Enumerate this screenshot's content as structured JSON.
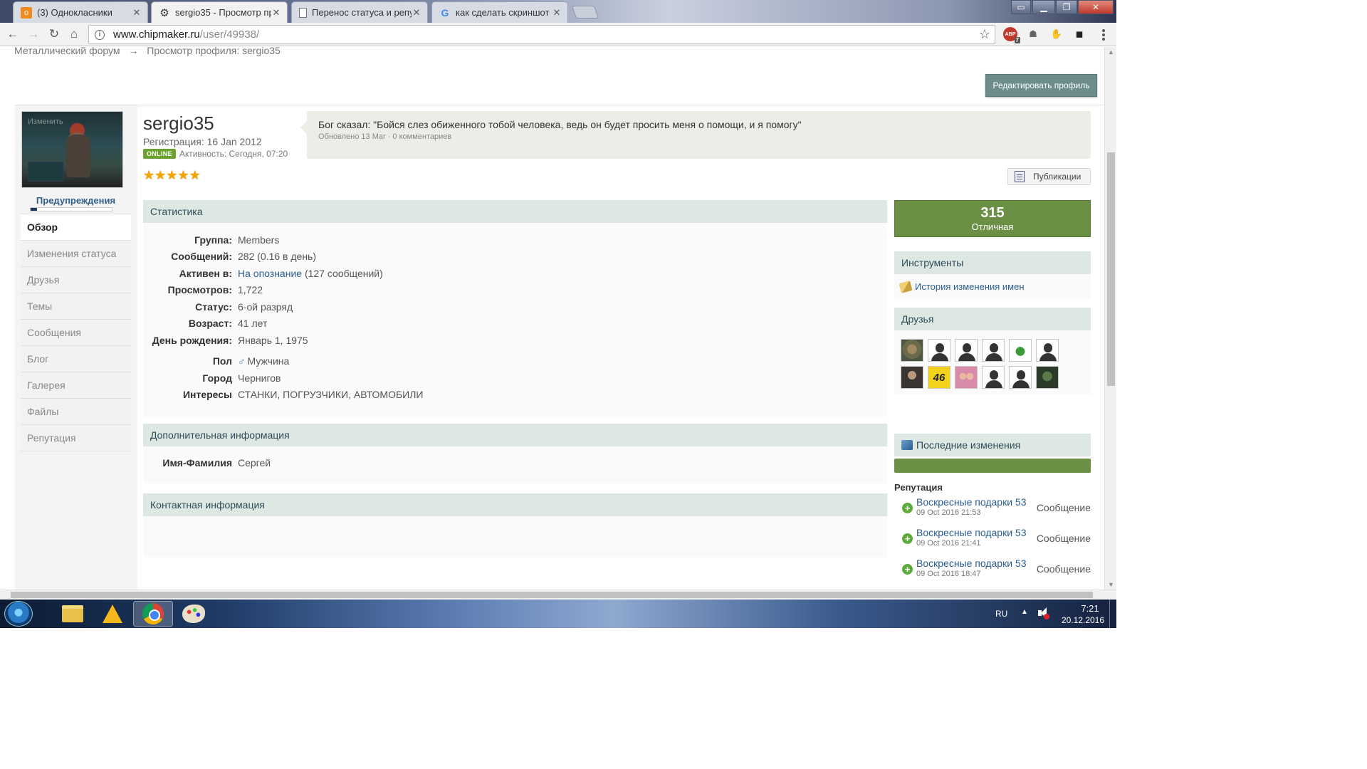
{
  "browser": {
    "tabs": [
      {
        "label": "(3) Однокласники",
        "icon": "ok-icon",
        "active": false
      },
      {
        "label": "sergio35 - Просмотр пр",
        "icon": "gear-icon",
        "active": true
      },
      {
        "label": "Перенос статуса и репу",
        "icon": "document-icon",
        "active": false
      },
      {
        "label": "как сделать скриншот н",
        "icon": "google-icon",
        "active": false
      }
    ],
    "url_host": "www.chipmaker.ru",
    "url_path": "/user/49938/",
    "abp_count": "7",
    "abp_label": "ABP"
  },
  "breadcrumb": {
    "items": [
      "Металлический форум",
      "Просмотр профиля: sergio35"
    ],
    "separator": "→"
  },
  "edit_profile_label": "Редактировать профиль",
  "profile": {
    "avatar_change_label": "Изменить",
    "warnings_label": "Предупреждения",
    "warnings_level": 0.08,
    "username": "sergio35",
    "registration": "Регистрация: 16 Jan 2012",
    "online_badge": "ONLINE",
    "activity": "Активность: Сегодня, 07:20",
    "rating_stars": 5,
    "status_text": "Бог сказал: \"Бойся слез обиженного тобой человека, ведь он будет просить меня о помощи, и я помогу\"",
    "status_meta": "Обновлено 13 Mar · 0 комментариев",
    "publications_label": "Публикации"
  },
  "sidenav": [
    {
      "label": "Обзор",
      "active": true
    },
    {
      "label": "Изменения статуса",
      "active": false
    },
    {
      "label": "Друзья",
      "active": false
    },
    {
      "label": "Темы",
      "active": false
    },
    {
      "label": "Сообщения",
      "active": false
    },
    {
      "label": "Блог",
      "active": false
    },
    {
      "label": "Галерея",
      "active": false
    },
    {
      "label": "Файлы",
      "active": false
    },
    {
      "label": "Репутация",
      "active": false
    }
  ],
  "stats": {
    "title": "Статистика",
    "rows": [
      {
        "key": "Группа:",
        "value": "Members"
      },
      {
        "key": "Сообщений:",
        "value": "282 (0.16 в день)"
      },
      {
        "key": "Активен в:",
        "value_link": "На опознание",
        "value": " (127 сообщений)"
      },
      {
        "key": "Просмотров:",
        "value": "1,722"
      },
      {
        "key": "Статус:",
        "value": "6-ой разряд"
      },
      {
        "key": "Возраст:",
        "value": "41 лет"
      },
      {
        "key": "День рождения:",
        "value": "Январь 1, 1975"
      },
      {
        "key": "Пол",
        "value": "Мужчина",
        "icon": "male-icon",
        "icon_glyph": "♂"
      },
      {
        "key": "Город",
        "value": "Чернигов"
      },
      {
        "key": "Интересы",
        "value": "СТАНКИ, ПОГРУЗЧИКИ, АВТОМОБИЛИ"
      }
    ]
  },
  "additional": {
    "title": "Дополнительная информация",
    "rows": [
      {
        "key": "Имя-Фамилия",
        "value": "Сергей"
      }
    ]
  },
  "contact": {
    "title": "Контактная информация"
  },
  "reputation": {
    "value": "315",
    "label": "Отличная"
  },
  "tools": {
    "title": "Инструменты",
    "link": "История изменения имен"
  },
  "friends": {
    "title": "Друзья",
    "avatars": [
      "dog",
      "blank",
      "blank",
      "blank",
      "frog",
      "blank",
      "man",
      "num46",
      "kids",
      "blank",
      "blank",
      "yoda"
    ],
    "num46_text": "46"
  },
  "recent": {
    "title": "Последние изменения",
    "reputation_title": "Репутация",
    "items": [
      {
        "title": "Воскресные подарки 53",
        "date": "09 Oct 2016 21:53",
        "type": "Сообщение"
      },
      {
        "title": "Воскресные подарки 53",
        "date": "09 Oct 2016 21:41",
        "type": "Сообщение"
      },
      {
        "title": "Воскресные подарки 53",
        "date": "09 Oct 2016 18:47",
        "type": "Сообщение"
      }
    ]
  },
  "taskbar": {
    "lang": "RU",
    "time": "7:21",
    "date": "20.12.2016"
  }
}
